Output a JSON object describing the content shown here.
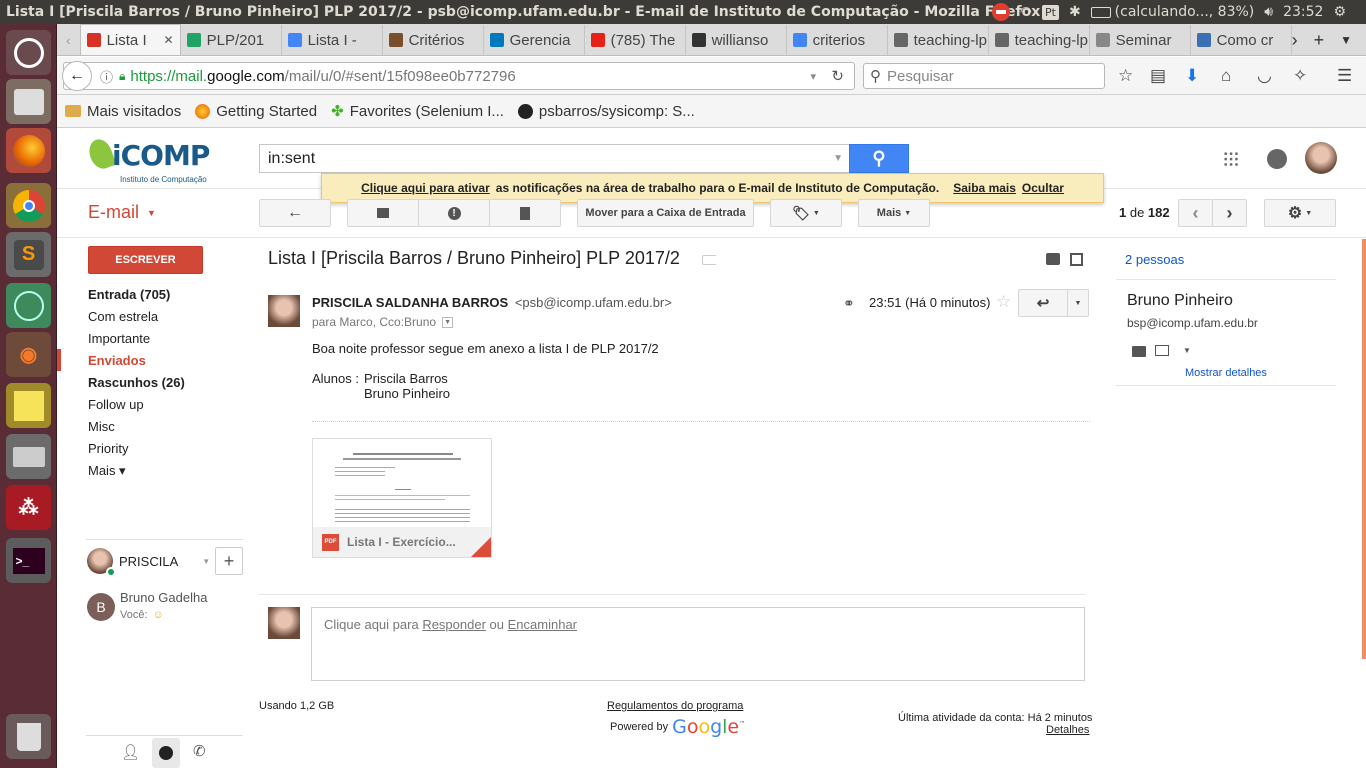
{
  "os": {
    "window_title": "Lista I [Priscila Barros / Bruno Pinheiro] PLP 2017/2 - psb@icomp.ufam.edu.br - E-mail de Instituto de Computação - Mozilla Firefox",
    "battery": "(calculando..., 83%)",
    "clock": "23:52",
    "keyboard": "Pt"
  },
  "browser": {
    "tabs": [
      {
        "label": "Lista I",
        "color": "#d93025",
        "active": true
      },
      {
        "label": "PLP/201",
        "color": "#1fa463"
      },
      {
        "label": "Lista I -",
        "color": "#4285f4"
      },
      {
        "label": "Critérios",
        "color": "#7a4f2c"
      },
      {
        "label": "Gerencia",
        "color": "#0079bf"
      },
      {
        "label": "(785) The",
        "color": "#e62117"
      },
      {
        "label": "willianso",
        "color": "#333333"
      },
      {
        "label": "criterios",
        "color": "#4285f4"
      },
      {
        "label": "teaching-lp",
        "color": "#666666"
      },
      {
        "label": "teaching-lp",
        "color": "#666666"
      },
      {
        "label": "Seminar",
        "color": "#888888"
      },
      {
        "label": "Como cr",
        "color": "#3b6fb6"
      }
    ],
    "url_prefix": "https://mail.",
    "url_domain": "google.com",
    "url_rest": "/mail/u/0/#sent/15f098ee0b772796",
    "search_placeholder": "Pesquisar",
    "bookmarks": [
      "Mais visitados",
      "Getting Started",
      "Favorites (Selenium I...",
      "psbarros/sysicomp: S..."
    ]
  },
  "gmail": {
    "logo_text": "iCOMP",
    "logo_sub": "Instituto de Computação",
    "search_value": "in:sent",
    "notification": {
      "link": "Clique aqui para ativar",
      "text": "as notificações na área de trabalho para o E-mail de Instituto de Computação.",
      "learn_more": "Saiba mais",
      "hide": "Ocultar"
    },
    "email_label": "E-mail",
    "toolbar": {
      "move_inbox": "Mover para a Caixa de Entrada",
      "more": "Mais",
      "count_current": "1",
      "count_sep": " de ",
      "count_total": "182"
    },
    "compose": "ESCREVER",
    "nav": [
      {
        "label": "Entrada (705)",
        "bold": true
      },
      {
        "label": "Com estrela"
      },
      {
        "label": "Importante"
      },
      {
        "label": "Enviados",
        "active": true
      },
      {
        "label": "Rascunhos (26)",
        "bold": true
      },
      {
        "label": "Follow up"
      },
      {
        "label": "Misc"
      },
      {
        "label": "Priority"
      },
      {
        "label": "Mais ▾"
      }
    ],
    "hangouts": {
      "user": "PRISCILA",
      "contact_name": "Bruno Gadelha",
      "contact_initial": "B",
      "contact_status": "Você:"
    },
    "thread": {
      "subject": "Lista I [Priscila Barros / Bruno Pinheiro] PLP 2017/2",
      "sender_name": "PRISCILA SALDANHA BARROS",
      "sender_email": "<psb@icomp.ufam.edu.br>",
      "recipients": "para Marco, Cco:Bruno",
      "time": "23:51 (Há 0 minutos)",
      "body_line1": "Boa noite professor segue em anexo a lista I de PLP 2017/2",
      "body_students_label": "Alunos :",
      "body_student1": "Priscila Barros",
      "body_student2": "Bruno Pinheiro",
      "attachment_name": "Lista I - Exercício...",
      "attachment_type": "PDF",
      "reply_prompt": "Clique aqui para",
      "reply_link": "Responder",
      "reply_or": "ou",
      "forward_link": "Encaminhar"
    },
    "right_panel": {
      "people": "2 pessoas",
      "name": "Bruno Pinheiro",
      "email": "bsp@icomp.ufam.edu.br",
      "details": "Mostrar detalhes"
    },
    "footer": {
      "usage": "Usando 1,2 GB",
      "program_policies": "Regulamentos do programa",
      "powered_by": "Powered by",
      "last_activity": "Última atividade da conta: Há 2 minutos",
      "details": "Detalhes"
    }
  }
}
